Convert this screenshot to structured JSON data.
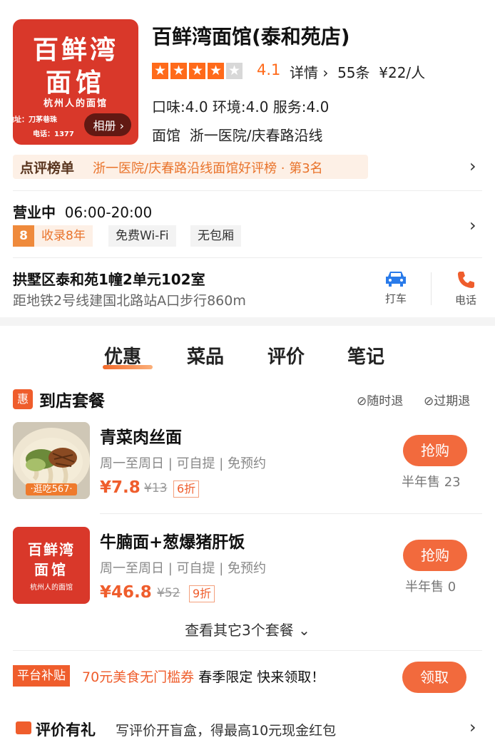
{
  "shop": {
    "name": "百鲜湾面馆(泰和苑店)",
    "logo_line1": "百鲜湾",
    "logo_line2": "面馆",
    "logo_line3": "杭州人的面馆",
    "logo_address": "地址：刀茅巷珠",
    "logo_phone": "电话：1377",
    "album_label": "相册",
    "rating": "4.1",
    "stars_filled": 4,
    "stars_total": 5,
    "detail_label": "详情",
    "review_count": "55条",
    "price_per_person": "¥22/人",
    "scores": "口味:4.0  环境:4.0  服务:4.0",
    "category": "面馆",
    "area": "浙一医院/庆春路沿线"
  },
  "rank": {
    "label": "点评榜单",
    "text": "浙一医院/庆春路沿线面馆好评榜 · 第3名"
  },
  "hours": {
    "status": "营业中",
    "time": "06:00-20:00"
  },
  "tags": {
    "years_num": "8",
    "years_text": "收录8年",
    "wifi": "免费Wi-Fi",
    "room": "无包厢"
  },
  "address": {
    "line": "拱墅区泰和苑1幢2单元102室",
    "distance": "距地铁2号线建国北路站A口步行860m",
    "taxi": "打车",
    "phone": "电话"
  },
  "tabs": [
    "优惠",
    "菜品",
    "评价",
    "笔记"
  ],
  "section": {
    "badge": "惠",
    "title": "到店套餐",
    "refund_any": "随时退",
    "refund_expired": "过期退"
  },
  "deals": [
    {
      "name": "青菜肉丝面",
      "desc": "周一至周日 | 可自提 | 免预约",
      "price": "¥7.8",
      "original": "¥13",
      "discount": "6折",
      "buy": "抢购",
      "sold": "半年售 23",
      "thumb_badge": "·逛吃567·"
    },
    {
      "name": "牛腩面+葱爆猪肝饭",
      "desc": "周一至周日 | 可自提 | 免预约",
      "price": "¥46.8",
      "original": "¥52",
      "discount": "9折",
      "buy": "抢购",
      "sold": "半年售 0",
      "thumb_l1": "百鲜湾",
      "thumb_l2": "面馆",
      "thumb_l3": "杭州人的面馆"
    }
  ],
  "more_deals": "查看其它3个套餐",
  "subsidy": {
    "badge": "平台补贴",
    "highlight": "70元美食无门槛券",
    "text": " 春季限定 快来领取！",
    "button": "领取"
  },
  "review_reward": {
    "title": "评价有礼",
    "text": "写评价开盲盒，得最高10元现金红包"
  },
  "colors": {
    "accent": "#f26a3d",
    "star": "#ff6a1a",
    "brand_red": "#d9382a"
  }
}
